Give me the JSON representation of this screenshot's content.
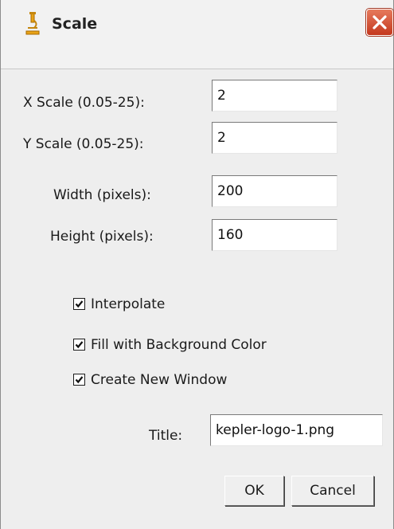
{
  "window": {
    "title": "Scale",
    "icon": "microscope-icon",
    "close_icon": "close-icon"
  },
  "fields": {
    "x_scale": {
      "label": "X Scale (0.05-25):",
      "value": "2"
    },
    "y_scale": {
      "label": "Y Scale (0.05-25):",
      "value": "2"
    },
    "width": {
      "label": "Width (pixels):",
      "value": "200"
    },
    "height": {
      "label": "Height (pixels):",
      "value": "160"
    },
    "title": {
      "label": "Title:",
      "value": "kepler-logo-1.png"
    }
  },
  "options": {
    "interpolate": {
      "label": "Interpolate",
      "checked": true
    },
    "fill_background": {
      "label": "Fill with Background Color",
      "checked": true
    },
    "create_new_window": {
      "label": "Create New Window",
      "checked": true
    }
  },
  "buttons": {
    "ok": "OK",
    "cancel": "Cancel"
  },
  "colors": {
    "dialog_background": "#eeeeee",
    "close_button": "#c4381e",
    "icon_accent": "#e8a317"
  }
}
